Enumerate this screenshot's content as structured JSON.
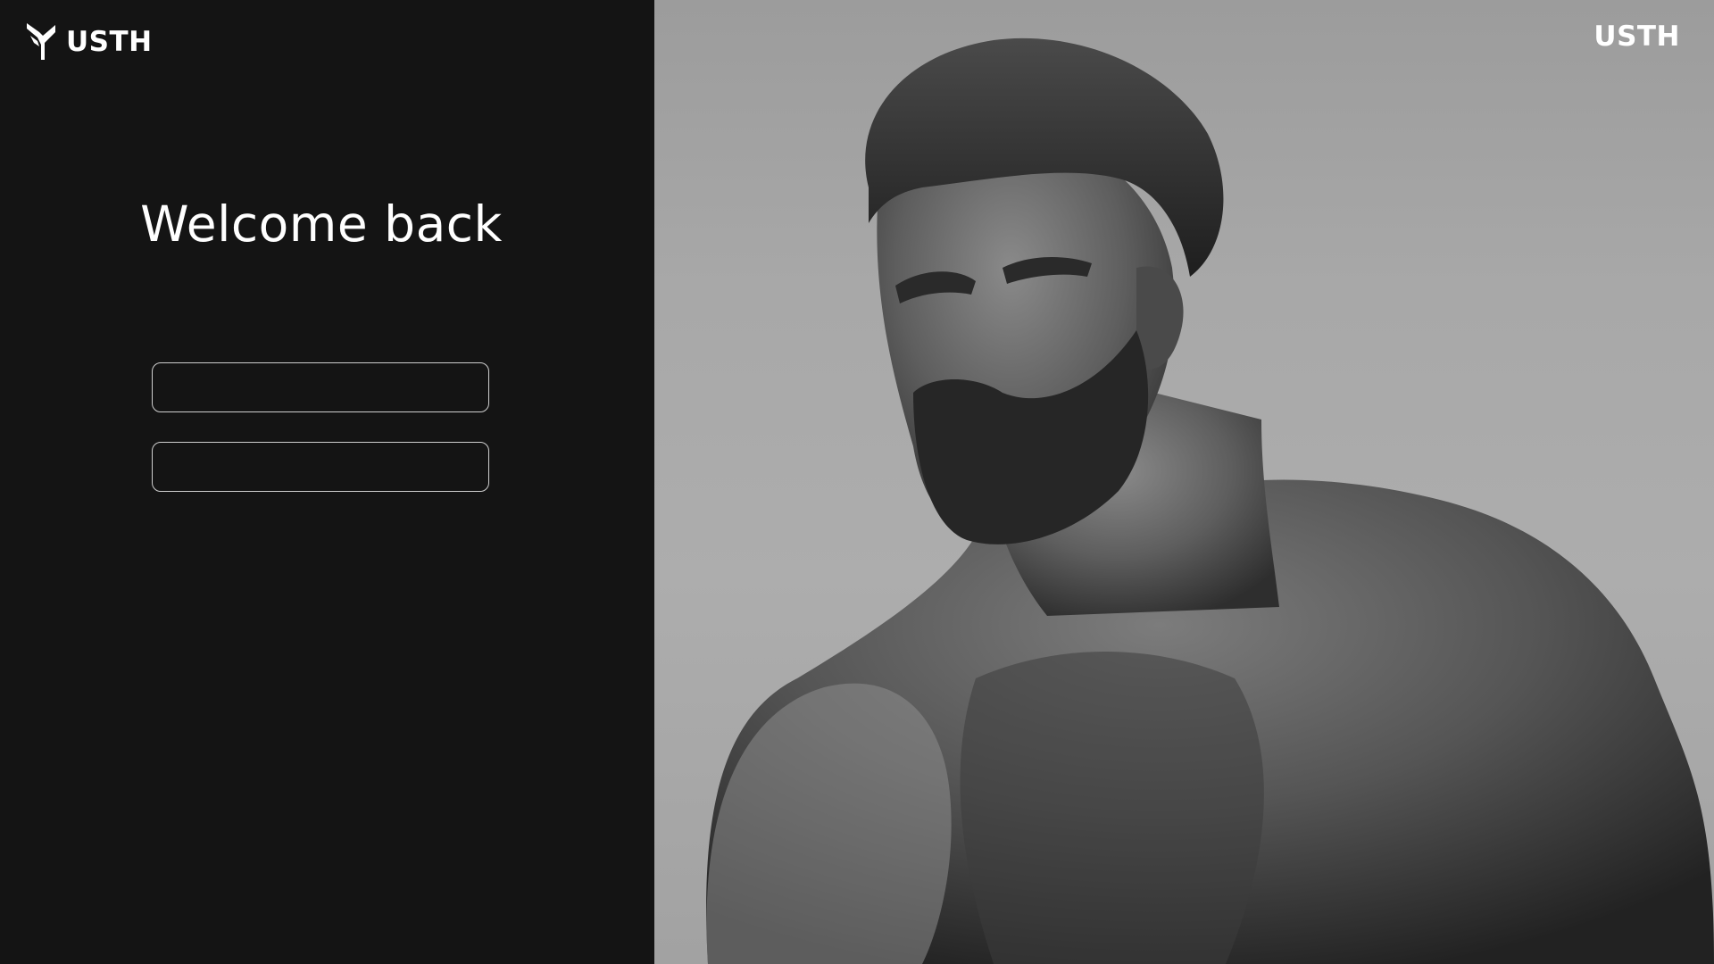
{
  "left_panel": {
    "brand": {
      "name": "USTH",
      "logo_icon": "usth-logo-icon"
    },
    "heading": "Welcome back",
    "fields": [
      {
        "value": "",
        "placeholder": ""
      },
      {
        "value": "",
        "placeholder": ""
      }
    ]
  },
  "right_panel": {
    "brand_name": "USTH",
    "hero_image": "monochrome-portrait-photo"
  },
  "colors": {
    "panel_background": "#141414",
    "text": "#ffffff",
    "field_border": "#cfcfcf"
  }
}
